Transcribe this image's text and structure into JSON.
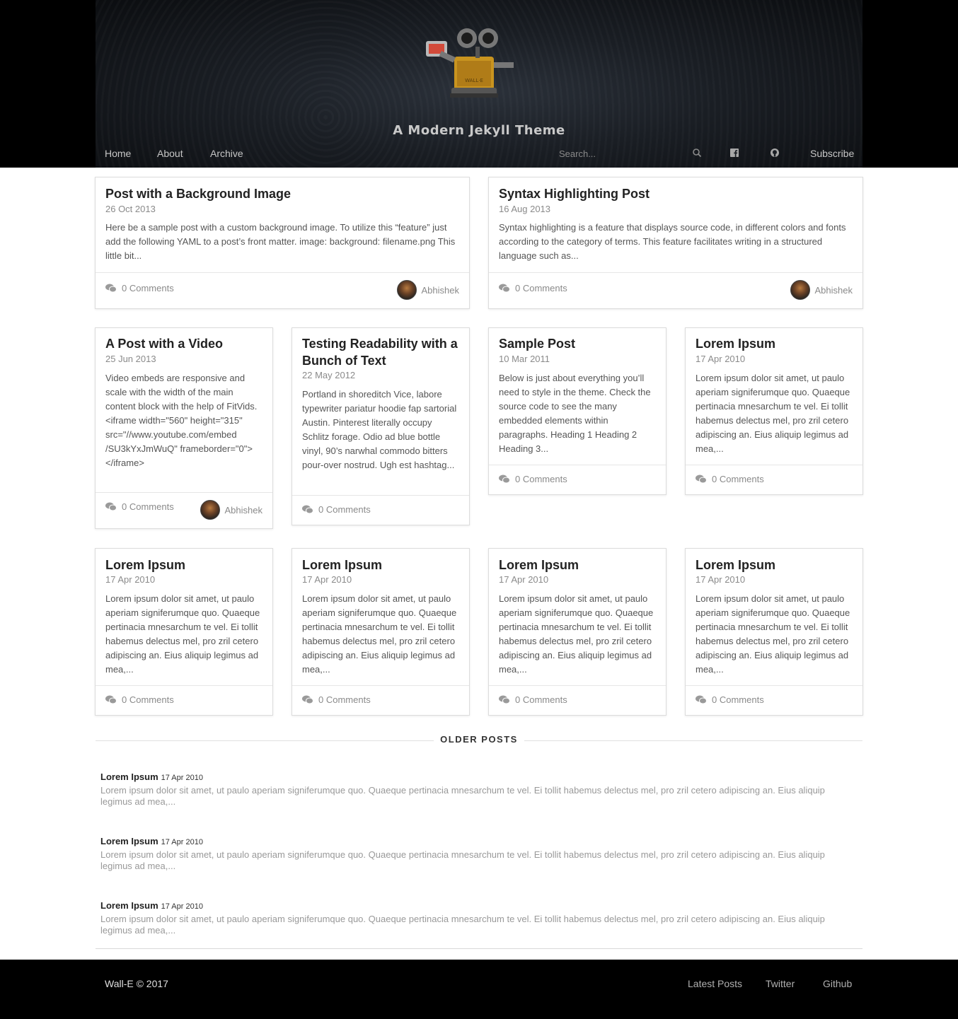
{
  "header": {
    "site_title": "A Modern Jekyll Theme",
    "nav": [
      "Home",
      "About",
      "Archive"
    ],
    "search_placeholder": "Search...",
    "subscribe_label": "Subscribe",
    "logo_text": "WALL·E"
  },
  "featured": [
    {
      "title": "Post with a Background Image",
      "date": "26 Oct 2013",
      "excerpt": "Here be a sample post with a custom background image. To utilize this “feature” just add the following YAML to a post’s front matter. image: background: filename.png This little bit...",
      "comments": "0 Comments",
      "author": "Abhishek"
    },
    {
      "title": "Syntax Highlighting Post",
      "date": "16 Aug 2013",
      "excerpt": "Syntax highlighting is a feature that displays source code, in different colors and fonts according to the category of terms. This feature facilitates writing in a structured language such as...",
      "comments": "0 Comments",
      "author": "Abhishek"
    }
  ],
  "row2": [
    {
      "title": "A Post with a Video",
      "date": "25 Jun 2013",
      "excerpt": "Video embeds are responsive and scale with the width of the main content block with the help of FitVids. <iframe width=\"560\" height=\"315\" src=\"//www.youtube.com/embed /SU3kYxJmWuQ\" frameborder=\"0\"></iframe>",
      "comments": "0 Comments",
      "author": "Abhishek"
    },
    {
      "title": "Testing Readability with a Bunch of Text",
      "date": "22 May 2012",
      "excerpt": "Portland in shoreditch Vice, labore typewriter pariatur hoodie fap sartorial Austin. Pinterest literally occupy Schlitz forage. Odio ad blue bottle vinyl, 90’s narwhal commodo bitters pour-over nostrud. Ugh est hashtag...",
      "comments": "0 Comments"
    },
    {
      "title": "Sample Post",
      "date": "10 Mar 2011",
      "excerpt": "Below is just about everything you’ll need to style in the theme. Check the source code to see the many embedded elements within paragraphs. Heading 1 Heading 2 Heading 3...",
      "comments": "0 Comments"
    },
    {
      "title": "Lorem Ipsum",
      "date": "17 Apr 2010",
      "excerpt": "Lorem ipsum dolor sit amet, ut paulo aperiam signiferumque quo. Quaeque pertinacia mnesarchum te vel. Ei tollit habemus delectus mel, pro zril cetero adipiscing an. Eius aliquip legimus ad mea,...",
      "comments": "0 Comments"
    }
  ],
  "row3": [
    {
      "title": "Lorem Ipsum",
      "date": "17 Apr 2010",
      "excerpt": "Lorem ipsum dolor sit amet, ut paulo aperiam signiferumque quo. Quaeque pertinacia mnesarchum te vel. Ei tollit habemus delectus mel, pro zril cetero adipiscing an. Eius aliquip legimus ad mea,...",
      "comments": "0 Comments"
    },
    {
      "title": "Lorem Ipsum",
      "date": "17 Apr 2010",
      "excerpt": "Lorem ipsum dolor sit amet, ut paulo aperiam signiferumque quo. Quaeque pertinacia mnesarchum te vel. Ei tollit habemus delectus mel, pro zril cetero adipiscing an. Eius aliquip legimus ad mea,...",
      "comments": "0 Comments"
    },
    {
      "title": "Lorem Ipsum",
      "date": "17 Apr 2010",
      "excerpt": "Lorem ipsum dolor sit amet, ut paulo aperiam signiferumque quo. Quaeque pertinacia mnesarchum te vel. Ei tollit habemus delectus mel, pro zril cetero adipiscing an. Eius aliquip legimus ad mea,...",
      "comments": "0 Comments"
    },
    {
      "title": "Lorem Ipsum",
      "date": "17 Apr 2010",
      "excerpt": "Lorem ipsum dolor sit amet, ut paulo aperiam signiferumque quo. Quaeque pertinacia mnesarchum te vel. Ei tollit habemus delectus mel, pro zril cetero adipiscing an. Eius aliquip legimus ad mea,...",
      "comments": "0 Comments"
    }
  ],
  "older": {
    "label": "OLDER POSTS",
    "items": [
      {
        "title": "Lorem Ipsum",
        "date": "17 Apr 2010",
        "excerpt": "Lorem ipsum dolor sit amet, ut paulo aperiam signiferumque quo. Quaeque pertinacia mnesarchum te vel. Ei tollit habemus delectus mel, pro zril cetero adipiscing an. Eius aliquip legimus ad mea,..."
      },
      {
        "title": "Lorem Ipsum",
        "date": "17 Apr 2010",
        "excerpt": "Lorem ipsum dolor sit amet, ut paulo aperiam signiferumque quo. Quaeque pertinacia mnesarchum te vel. Ei tollit habemus delectus mel, pro zril cetero adipiscing an. Eius aliquip legimus ad mea,..."
      },
      {
        "title": "Lorem Ipsum",
        "date": "17 Apr 2010",
        "excerpt": "Lorem ipsum dolor sit amet, ut paulo aperiam signiferumque quo. Quaeque pertinacia mnesarchum te vel. Ei tollit habemus delectus mel, pro zril cetero adipiscing an. Eius aliquip legimus ad mea,..."
      }
    ]
  },
  "footer": {
    "copyright": "Wall-E © 2017",
    "links": [
      "Latest Posts",
      "Twitter",
      "Github"
    ]
  },
  "icons": {
    "search": "search-icon",
    "facebook": "facebook-icon",
    "github": "github-icon",
    "comments": "comments-icon"
  }
}
